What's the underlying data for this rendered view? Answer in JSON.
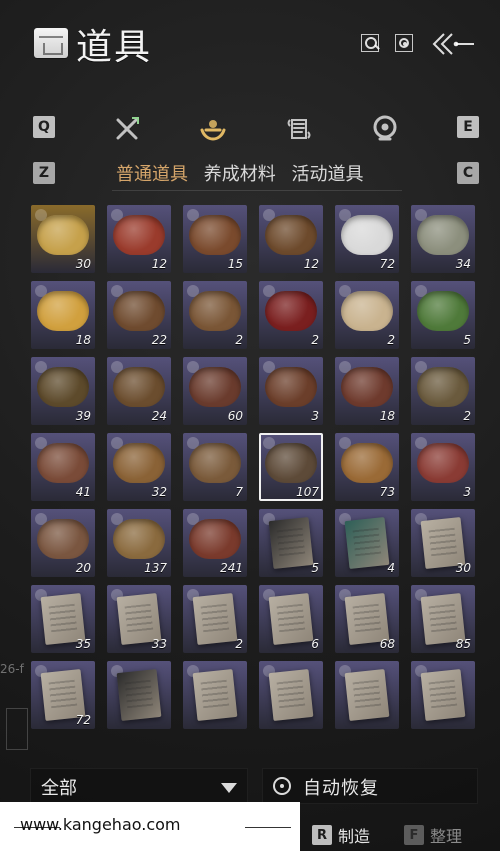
{
  "header": {
    "title": "道具",
    "icons": [
      "search-icon",
      "gear-icon",
      "back-arrows-icon",
      "inventory-logo-icon"
    ]
  },
  "tabs": {
    "left_key": "Q",
    "right_key": "E",
    "left_sub_key": "Z",
    "right_sub_key": "C",
    "categories": [
      {
        "name": "weapons",
        "icon": "crossed-swords-icon"
      },
      {
        "name": "consumables",
        "icon": "dish-bowl-icon"
      },
      {
        "name": "scrolls",
        "icon": "scroll-icon"
      },
      {
        "name": "materials",
        "icon": "orb-icon"
      }
    ]
  },
  "subtabs": [
    {
      "label": "普通道具",
      "active": true
    },
    {
      "label": "养成材料",
      "active": false
    },
    {
      "label": "活动道具",
      "active": false
    }
  ],
  "items": [
    {
      "count": "30",
      "kind": "coin",
      "color": "#c6a14b"
    },
    {
      "count": "12",
      "kind": "flag",
      "color": "#9a3b2c"
    },
    {
      "count": "15",
      "kind": "dish",
      "color": "#7a4a2d"
    },
    {
      "count": "12",
      "kind": "dish",
      "color": "#6d4a2c"
    },
    {
      "count": "72",
      "kind": "buns",
      "color": "#d9d9d9"
    },
    {
      "count": "34",
      "kind": "dish",
      "color": "#8c8f7d"
    },
    {
      "count": "18",
      "kind": "soup",
      "color": "#d1a03e"
    },
    {
      "count": "22",
      "kind": "dish",
      "color": "#6f4b2f"
    },
    {
      "count": "2",
      "kind": "dish",
      "color": "#7a5636"
    },
    {
      "count": "2",
      "kind": "jar",
      "color": "#7a1f1f"
    },
    {
      "count": "2",
      "kind": "egg",
      "color": "#c9b38f"
    },
    {
      "count": "5",
      "kind": "greens",
      "color": "#4f7a3a"
    },
    {
      "count": "39",
      "kind": "dish",
      "color": "#5d4a2b"
    },
    {
      "count": "24",
      "kind": "dish",
      "color": "#6b4d2e"
    },
    {
      "count": "60",
      "kind": "dish",
      "color": "#6a3b2d"
    },
    {
      "count": "3",
      "kind": "balls",
      "color": "#6b3e2a"
    },
    {
      "count": "18",
      "kind": "dish",
      "color": "#6e3a2d"
    },
    {
      "count": "2",
      "kind": "dish",
      "color": "#6a5a3d"
    },
    {
      "count": "41",
      "kind": "dish",
      "color": "#7a4b38"
    },
    {
      "count": "32",
      "kind": "dish",
      "color": "#8a6236"
    },
    {
      "count": "7",
      "kind": "cakes",
      "color": "#7a5a3a"
    },
    {
      "count": "107",
      "kind": "dish",
      "color": "#5d4a38"
    },
    {
      "count": "73",
      "kind": "dish",
      "color": "#9a6a36"
    },
    {
      "count": "3",
      "kind": "meat",
      "color": "#8a3b34"
    },
    {
      "count": "20",
      "kind": "dish",
      "color": "#7a5640"
    },
    {
      "count": "137",
      "kind": "dish",
      "color": "#8a6a3e"
    },
    {
      "count": "241",
      "kind": "dish",
      "color": "#7a3a2c"
    },
    {
      "count": "5",
      "kind": "paper",
      "color": "#2b2b2b"
    },
    {
      "count": "4",
      "kind": "paper",
      "color": "#2d5f57"
    },
    {
      "count": "30",
      "kind": "paper",
      "color": "#b8b0a2"
    },
    {
      "count": "35",
      "kind": "paper",
      "color": "#b7afa2"
    },
    {
      "count": "33",
      "kind": "paper",
      "color": "#b7afa2"
    },
    {
      "count": "2",
      "kind": "paper",
      "color": "#b7afa2"
    },
    {
      "count": "6",
      "kind": "paper",
      "color": "#b7afa2"
    },
    {
      "count": "68",
      "kind": "paper",
      "color": "#b7afa2"
    },
    {
      "count": "85",
      "kind": "paper",
      "color": "#b7afa2"
    },
    {
      "count": "72",
      "kind": "paper",
      "color": "#b7afa2"
    },
    {
      "count": "",
      "kind": "paper",
      "color": "#2b2b2b"
    },
    {
      "count": "",
      "kind": "paper",
      "color": "#b7afa2"
    },
    {
      "count": "",
      "kind": "paper",
      "color": "#b7afa2"
    },
    {
      "count": "",
      "kind": "paper",
      "color": "#b7afa2"
    },
    {
      "count": "",
      "kind": "paper",
      "color": "#b7afa2"
    }
  ],
  "selected_index": 21,
  "bottom": {
    "filter_label": "全部",
    "auto_recover_label": "自动恢复",
    "watermark_text": "www.kangehao.com",
    "left_overlay_text": "26-f"
  },
  "actions": [
    {
      "key": "R",
      "label": "制造",
      "enabled": true
    },
    {
      "key": "F",
      "label": "整理",
      "enabled": false
    }
  ]
}
